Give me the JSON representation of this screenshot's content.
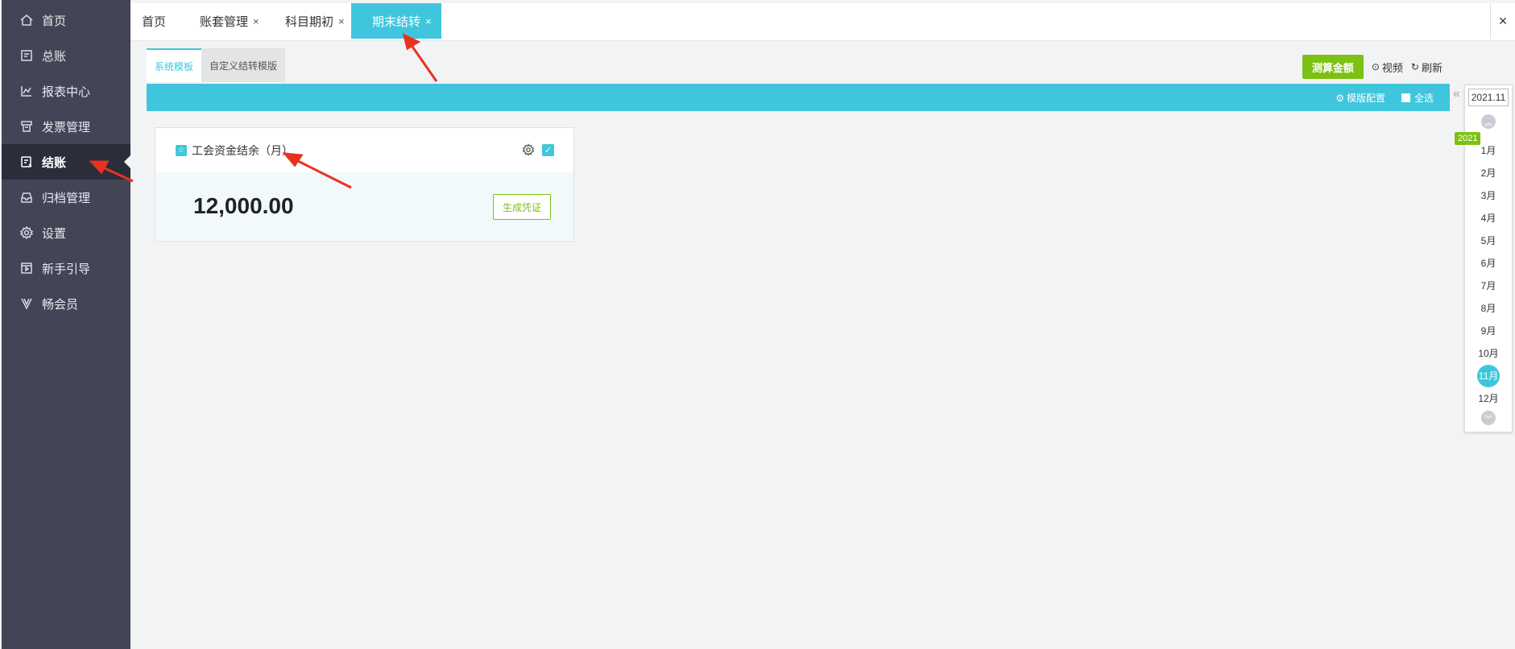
{
  "sidebar": {
    "items": [
      {
        "label": "首页",
        "icon": "home-icon"
      },
      {
        "label": "总账",
        "icon": "ledger-icon"
      },
      {
        "label": "报表中心",
        "icon": "chart-icon"
      },
      {
        "label": "发票管理",
        "icon": "invoice-icon"
      },
      {
        "label": "结账",
        "icon": "checkout-icon",
        "active": true
      },
      {
        "label": "归档管理",
        "icon": "archive-icon"
      },
      {
        "label": "设置",
        "icon": "settings-icon"
      },
      {
        "label": "新手引导",
        "icon": "guide-icon"
      },
      {
        "label": "畅会员",
        "icon": "vip-icon"
      }
    ]
  },
  "tabs": [
    {
      "label": "首页"
    },
    {
      "label": "账套管理",
      "close": "×"
    },
    {
      "label": "科目期初",
      "close": "×"
    },
    {
      "label": "期末结转",
      "close": "×",
      "active": true
    }
  ],
  "close_all": "×",
  "subtabs": [
    {
      "label": "系统模板",
      "active": true
    },
    {
      "label": "自定义结转模版"
    }
  ],
  "toolbar": {
    "calc_button": "测算金额",
    "video": "视频",
    "refresh": "刷新"
  },
  "bar": {
    "template_config": "模版配置",
    "select_all": "全选",
    "collapse": "«"
  },
  "card": {
    "badge": "☆",
    "title": "工会资金结余（月）",
    "amount": "12,000.00",
    "generate_button": "生成凭证",
    "checked": true
  },
  "period": {
    "value": "2021.11",
    "year": "2021",
    "months": [
      "1月",
      "2月",
      "3月",
      "4月",
      "5月",
      "6月",
      "7月",
      "8月",
      "9月",
      "10月",
      "11月",
      "12月"
    ],
    "selected": "11月"
  },
  "colors": {
    "accent": "#3fc6dc",
    "green": "#7cc114",
    "sidebar": "#434556",
    "annotation": "#e8321f"
  }
}
